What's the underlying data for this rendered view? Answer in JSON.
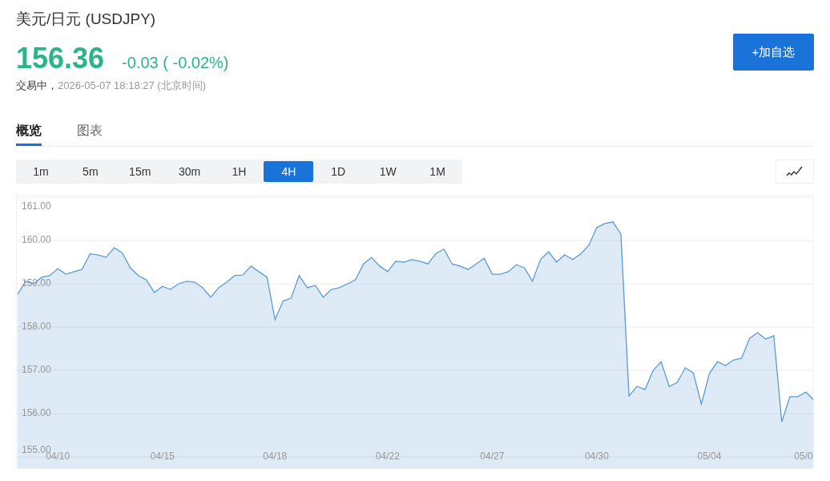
{
  "header": {
    "title": "美元/日元 (USDJPY)",
    "price": "156.36",
    "change": "-0.03 ( -0.02%)",
    "status": "交易中，",
    "timestamp": "2026-05-07 18:18:27 (北京时间)",
    "add_button": "+加自选"
  },
  "tabs": [
    {
      "label": "概览",
      "selected": true
    },
    {
      "label": "图表",
      "selected": false
    }
  ],
  "periods": [
    {
      "label": "1m",
      "selected": false
    },
    {
      "label": "5m",
      "selected": false
    },
    {
      "label": "15m",
      "selected": false
    },
    {
      "label": "30m",
      "selected": false
    },
    {
      "label": "1H",
      "selected": false
    },
    {
      "label": "4H",
      "selected": true
    },
    {
      "label": "1D",
      "selected": false
    },
    {
      "label": "1W",
      "selected": false
    },
    {
      "label": "1M",
      "selected": false
    }
  ],
  "chart": {
    "chart_data": {
      "type": "area",
      "categories": [
        null,
        null,
        null,
        null,
        null,
        "04/10",
        null,
        null,
        null,
        null,
        null,
        null,
        null,
        null,
        null,
        null,
        null,
        null,
        "04/15",
        null,
        null,
        null,
        null,
        null,
        null,
        null,
        null,
        null,
        null,
        null,
        null,
        null,
        "04/18",
        null,
        null,
        null,
        null,
        null,
        null,
        null,
        null,
        null,
        null,
        null,
        null,
        null,
        "04/22",
        null,
        null,
        null,
        null,
        null,
        null,
        null,
        null,
        null,
        null,
        null,
        null,
        "04/27",
        null,
        null,
        null,
        null,
        null,
        null,
        null,
        null,
        null,
        null,
        null,
        null,
        "04/30",
        null,
        null,
        null,
        null,
        null,
        null,
        null,
        null,
        null,
        null,
        null,
        null,
        null,
        "05/04",
        null,
        null,
        null,
        null,
        null,
        null,
        null,
        null,
        null,
        null,
        null,
        "05/0",
        null
      ],
      "series": [
        {
          "color": "#5a9bd5",
          "values": [
            158.76,
            159.06,
            159.0,
            159.15,
            159.19,
            159.35,
            159.22,
            159.28,
            159.33,
            159.69,
            159.67,
            159.61,
            159.83,
            159.72,
            159.37,
            159.19,
            159.09,
            158.8,
            158.94,
            158.87,
            159.0,
            159.06,
            159.04,
            158.91,
            158.69,
            158.91,
            159.04,
            159.19,
            159.2,
            159.41,
            159.28,
            159.15,
            158.17,
            158.6,
            158.67,
            159.19,
            158.91,
            158.96,
            158.69,
            158.87,
            158.91,
            159.0,
            159.09,
            159.46,
            159.61,
            159.41,
            159.28,
            159.52,
            159.5,
            159.56,
            159.52,
            159.46,
            159.7,
            159.8,
            159.46,
            159.41,
            159.33,
            159.46,
            159.59,
            159.22,
            159.22,
            159.28,
            159.44,
            159.37,
            159.06,
            159.56,
            159.74,
            159.5,
            159.67,
            159.56,
            159.69,
            159.89,
            160.3,
            160.39,
            160.43,
            160.15,
            156.41,
            156.63,
            156.56,
            157.0,
            157.2,
            156.63,
            156.72,
            157.06,
            156.94,
            156.22,
            156.93,
            157.2,
            157.11,
            157.24,
            157.28,
            157.74,
            157.87,
            157.72,
            157.8,
            155.81,
            156.39,
            156.39,
            156.5,
            156.31
          ]
        }
      ],
      "ylim": [
        155,
        161
      ],
      "yticks": [
        {
          "value": 161,
          "label": "161.00"
        },
        {
          "value": 160,
          "label": "160.00"
        },
        {
          "value": 159,
          "label": "159.00"
        },
        {
          "value": 158,
          "label": "158.00"
        },
        {
          "value": 157,
          "label": "157.00"
        },
        {
          "value": 156,
          "label": "156.00"
        },
        {
          "value": 155,
          "label": "155.00"
        }
      ],
      "grid": true
    }
  }
}
